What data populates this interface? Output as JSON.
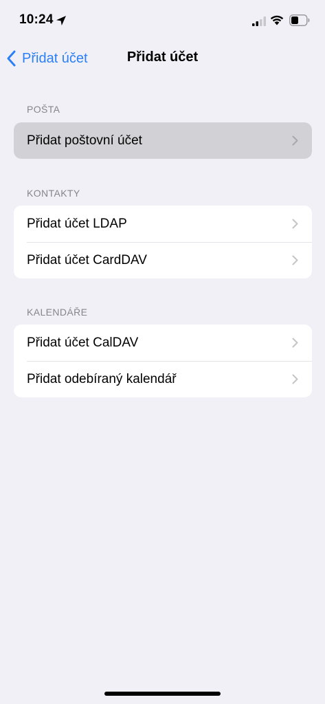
{
  "status_bar": {
    "time": "10:24"
  },
  "nav": {
    "back_label": "Přidat účet",
    "title": "Přidat účet"
  },
  "sections": [
    {
      "header": "POŠTA",
      "rows": [
        {
          "label": "Přidat poštovní účet",
          "highlighted": true
        }
      ]
    },
    {
      "header": "KONTAKTY",
      "rows": [
        {
          "label": "Přidat účet LDAP"
        },
        {
          "label": "Přidat účet CardDAV"
        }
      ]
    },
    {
      "header": "KALENDÁŘE",
      "rows": [
        {
          "label": "Přidat účet CalDAV"
        },
        {
          "label": "Přidat odebíraný kalendář"
        }
      ]
    }
  ],
  "colors": {
    "accent": "#2b7ff6",
    "background": "#f1f0f6",
    "section_header": "#85858a",
    "highlight": "#d1d1d6"
  },
  "icons": {
    "location": "location-arrow-icon",
    "signal": "cellular-signal-icon",
    "wifi": "wifi-icon",
    "battery": "battery-icon",
    "back": "chevron-left-icon",
    "disclosure": "chevron-right-icon"
  }
}
